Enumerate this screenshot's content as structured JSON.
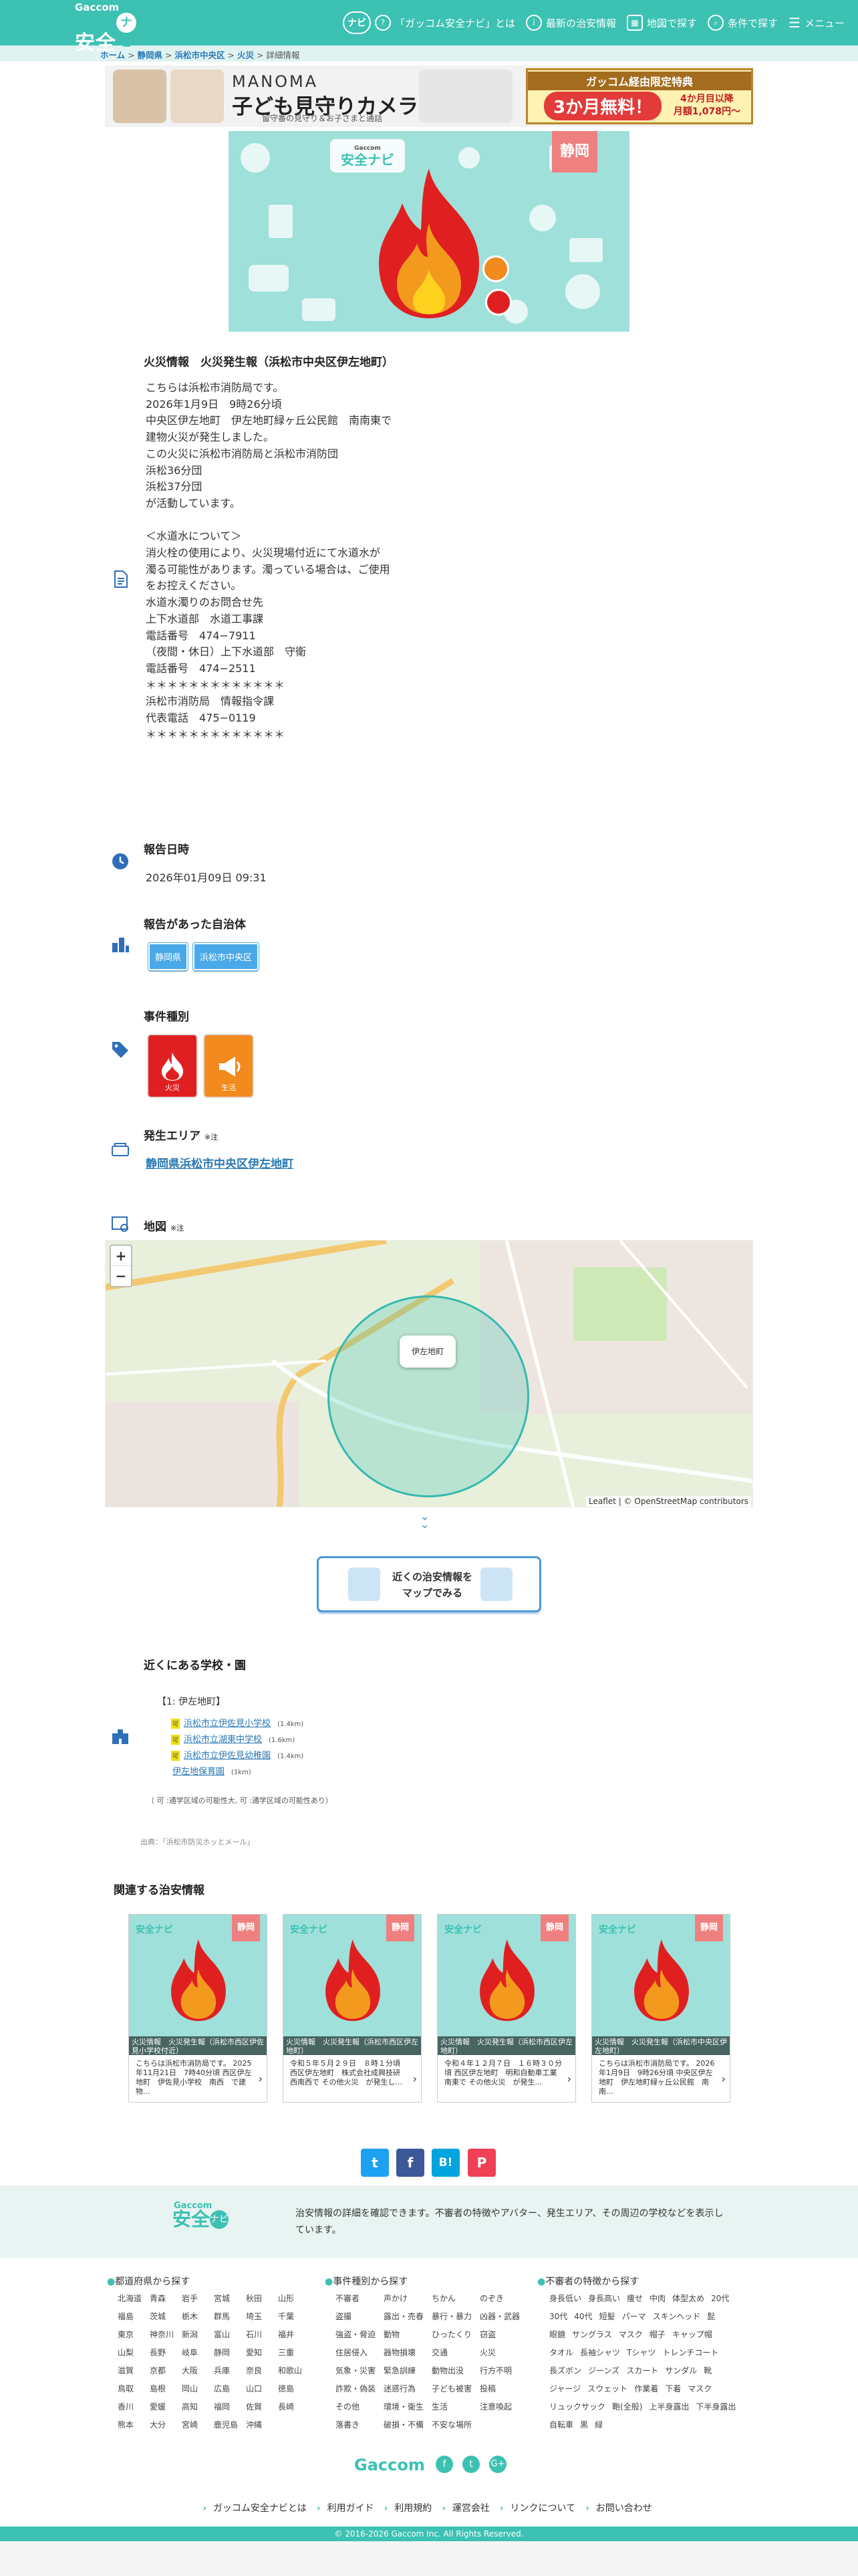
{
  "brand": {
    "small": "Gaccom",
    "main": "安全",
    "nav": "ナビ"
  },
  "header": {
    "about": "「ガッコム安全ナビ」とは",
    "latest": "最新の治安情報",
    "map": "地図で探す",
    "cond": "条件で探す",
    "menu": "メニュー"
  },
  "breadcrumb": [
    "ホーム",
    "静岡県",
    "浜松市中央区",
    "火災",
    "詳細情報"
  ],
  "banner": {
    "brand": "MANOMA",
    "title": "子ども見守りカメラ",
    "sub": "留守番の見守り＆お子さまと通話",
    "promo_head": "ガッコム経由限定特典",
    "promo_main": "3か月無料！",
    "promo_note1": "4か月目以降",
    "promo_note2": "月額1,078円〜"
  },
  "hero": {
    "pref": "静岡",
    "logo_small": "Gaccom",
    "logo": "安全ナビ"
  },
  "incident": {
    "title": "火災情報　火災発生報（浜松市中央区伊左地町）",
    "body": "こちらは浜松市消防局です。\n2026年1月9日　9時26分頃\n中央区伊左地町　伊左地町緑ヶ丘公民館　南南東で\n建物火災が発生しました。\nこの火災に浜松市消防局と浜松市消防団\n浜松36分団\n浜松37分団\nが活動しています。\n\n＜水道水について＞\n消火栓の使用により、火災現場付近にて水道水が\n濁る可能性があります。濁っている場合は、ご使用\nをお控えください。\n水道水濁りのお問合せ先\n上下水道部　水道工事課\n電話番号　474−7911\n（夜間・休日）上下水道部　守衛\n電話番号　474−2511\n＊＊＊＊＊＊＊＊＊＊＊＊＊\n浜松市消防局　情報指令課\n代表電話　475−0119\n＊＊＊＊＊＊＊＊＊＊＊＊＊"
  },
  "report": {
    "label": "報告日時",
    "value": "2026年01月09日 09:31"
  },
  "municipality": {
    "label": "報告があった自治体",
    "tags": [
      "静岡県",
      "浜松市中央区"
    ]
  },
  "kinds": {
    "label": "事件種別",
    "items": [
      "火災",
      "生活"
    ]
  },
  "area": {
    "label": "発生エリア",
    "note": "※注",
    "value": "静岡県浜松市中央区伊左地町"
  },
  "map": {
    "label": "地図",
    "note": "※注",
    "popup": "伊左地町",
    "zoom_in": "+",
    "zoom_out": "−",
    "attribution": "Leaflet | © OpenStreetMap contributors",
    "button": "近くの治安情報を\nマップでみる"
  },
  "schools": {
    "label": "近くにある学校・園",
    "group": "【1: 伊左地町】",
    "items": [
      {
        "name": "浜松市立伊佐見小学校",
        "dist": "(1.4km)",
        "badge": "可"
      },
      {
        "name": "浜松市立湖東中学校",
        "dist": "(1.6km)",
        "badge": "可"
      },
      {
        "name": "浜松市立伊佐見幼稚園",
        "dist": "(1.4km)",
        "badge": "可"
      },
      {
        "name": "伊左地保育園",
        "dist": "(1km)",
        "badge": ""
      }
    ],
    "legend": "（ 可 :通学区域の可能性大,  可 :通学区域の可能性あり）",
    "source": "出典：「浜松市防災ホッとメール」"
  },
  "related": {
    "label": "関連する治安情報",
    "cards": [
      {
        "cap": "火災情報　火災発生報（浜松市西区伊佐見小学校付近）",
        "text": "こちらは浜松市消防局です。 2025年11月21日　7時40分頃 西区伊左地町　伊佐見小学校　南西　で建物..."
      },
      {
        "cap": "火災情報　火災発生報（浜松市西区伊左地町）",
        "text": "令和５年５月２９日　８時１分頃 西区伊左地町　株式会社成興技研　西南西で その他火災　が発生し..."
      },
      {
        "cap": "火災情報　火災発生報（浜松市西区伊左地町）",
        "text": "令和４年１２月７日　１６時３０分頃 西区伊左地町　明和自動車工業　南東で その他火災　が発生..."
      },
      {
        "cap": "火災情報　火災発生報（浜松市中央区伊左地町）",
        "text": "こちらは浜松市消防局です。 2026年1月9日　9時26分頃 中央区伊左地町　伊左地町緑ヶ丘公民館　南南..."
      }
    ]
  },
  "share": {
    "tw": "t",
    "fb": "f",
    "hb": "B!",
    "pk": "P"
  },
  "footer": {
    "desc": "治安情報の詳細を確認できます。不審者の特徴やアバター、発生エリア、その周辺の学校などを表示しています。",
    "pref_head": "都道府県から探す",
    "prefs": [
      "北海道",
      "青森",
      "岩手",
      "宮城",
      "秋田",
      "山形",
      "福島",
      "茨城",
      "栃木",
      "群馬",
      "埼玉",
      "千葉",
      "東京",
      "神奈川",
      "新潟",
      "富山",
      "石川",
      "福井",
      "山梨",
      "長野",
      "岐阜",
      "静岡",
      "愛知",
      "三重",
      "滋賀",
      "京都",
      "大阪",
      "兵庫",
      "奈良",
      "和歌山",
      "鳥取",
      "島根",
      "岡山",
      "広島",
      "山口",
      "徳島",
      "香川",
      "愛媛",
      "高知",
      "福岡",
      "佐賀",
      "長崎",
      "熊本",
      "大分",
      "宮崎",
      "鹿児島",
      "沖縄"
    ],
    "kind_head": "事件種別から探す",
    "kinds": [
      "不審者",
      "声かけ",
      "ちかん",
      "のぞき",
      "盗撮",
      "露出・売春",
      "暴行・暴力",
      "凶器・武器",
      "強盗・脅迫",
      "動物",
      "ひったくり",
      "窃盗",
      "住居侵入",
      "器物損壊",
      "交通",
      "火災",
      "気象・災害",
      "緊急訓練",
      "動物出没",
      "行方不明",
      "詐欺・偽装",
      "迷惑行為",
      "子ども被害",
      "投稿",
      "その他",
      "環境・衛生",
      "生活",
      "注意喚起",
      "落書き",
      "破損・不備",
      "不安な場所"
    ],
    "feat_head": "不審者の特徴から探す",
    "feats": [
      "身長低い",
      "身長高い",
      "痩せ",
      "中肉",
      "体型太め",
      "20代",
      "30代",
      "40代",
      "短髪",
      "パーマ",
      "スキンヘッド",
      "髭",
      "眼鏡",
      "サングラス",
      "マスク",
      "帽子",
      "キャップ帽",
      "タオル",
      "長袖シャツ",
      "Tシャツ",
      "トレンチコート",
      "長ズボン",
      "ジーンズ",
      "スカート",
      "サンダル",
      "靴",
      "ジャージ",
      "スウェット",
      "作業着",
      "下着",
      "マスク",
      "リュックサック",
      "鞄(全般)",
      "上半身露出",
      "下半身露出",
      "自転車",
      "黒",
      "緑"
    ],
    "links": [
      "ガッコム安全ナビとは",
      "利用ガイド",
      "利用規約",
      "運営会社",
      "リンクについて",
      "お問い合わせ"
    ],
    "copy": "© 2016-2026 Gaccom Inc. All Rights Reserved.",
    "logo": "Gaccom"
  },
  "colors": {
    "accent": "#3cc1b3",
    "link": "#2878b5",
    "fire": "#e02020",
    "tag": "#4aa9e8"
  }
}
